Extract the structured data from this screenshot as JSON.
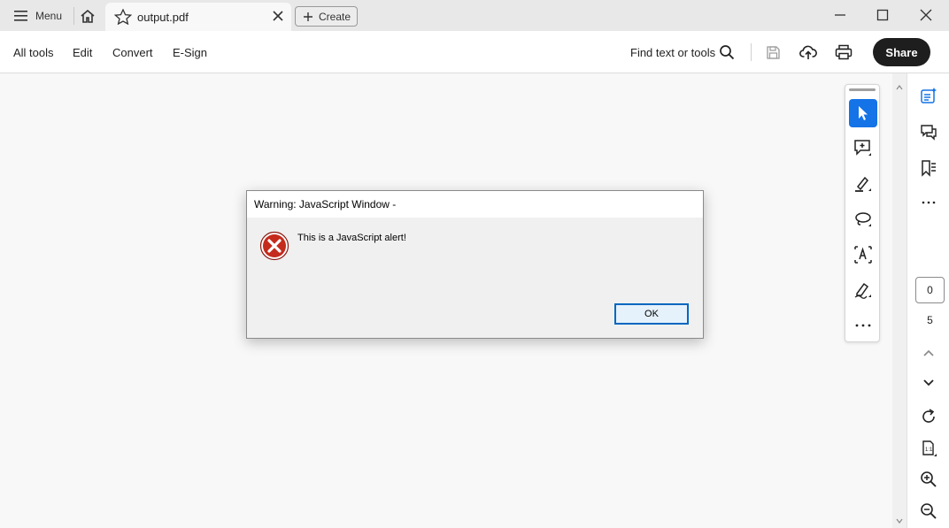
{
  "tabbar": {
    "menu_label": "Menu",
    "tab_name": "output.pdf",
    "create_label": "Create"
  },
  "toolbar": {
    "all_tools": "All tools",
    "edit": "Edit",
    "convert": "Convert",
    "esign": "E-Sign",
    "find_label": "Find text or tools",
    "share_label": "Share"
  },
  "page_nav": {
    "current_page": "0",
    "total_pages": "5"
  },
  "dialog": {
    "title": "Warning: JavaScript Window -",
    "message": "This is a JavaScript alert!",
    "ok_label": "OK"
  },
  "colors": {
    "accent": "#1473e6",
    "share_bg": "#1e1e1e",
    "error_red": "#c42b1c",
    "ok_border": "#0067c0"
  },
  "icons": [
    "menu-icon",
    "home-icon",
    "star-icon",
    "tab-close-icon",
    "plus-icon",
    "minimize-icon",
    "maximize-icon",
    "window-close-icon",
    "search-icon",
    "save-icon",
    "cloud-upload-icon",
    "print-icon",
    "select-cursor-icon",
    "add-comment-icon",
    "highlight-icon",
    "lasso-draw-icon",
    "text-recognition-icon",
    "sign-pen-icon",
    "more-icon",
    "ai-assistant-icon",
    "comments-icon",
    "bookmark-icon",
    "chevron-up-icon",
    "chevron-down-icon",
    "rotate-icon",
    "actual-size-icon",
    "zoom-in-icon",
    "zoom-out-icon",
    "error-icon"
  ]
}
